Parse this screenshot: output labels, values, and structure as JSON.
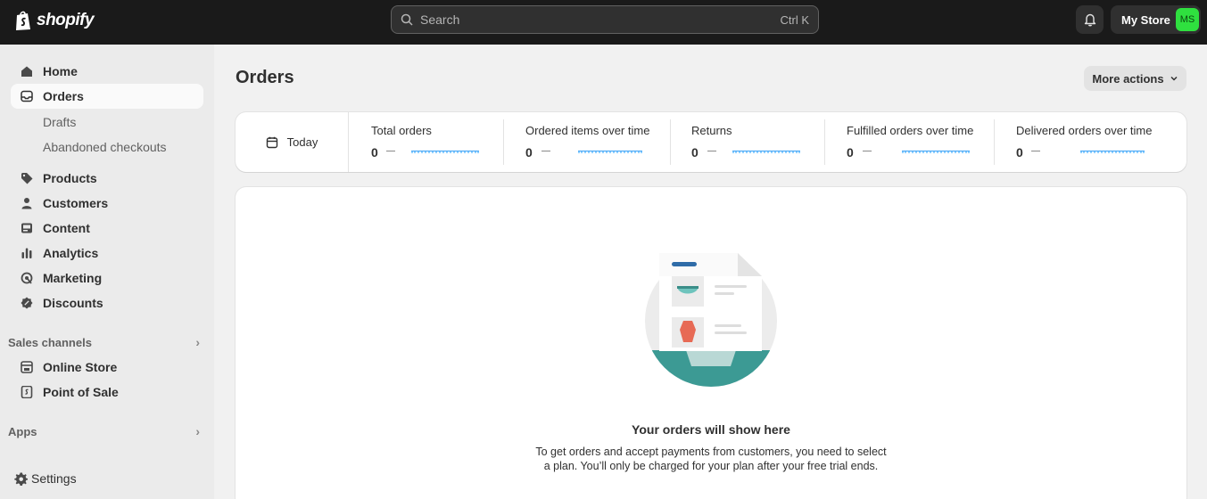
{
  "topbar": {
    "logo_text": "shopify",
    "search_placeholder": "Search",
    "search_shortcut": "Ctrl K",
    "store_name": "My Store",
    "avatar_initials": "MS"
  },
  "sidebar": {
    "items": [
      {
        "label": "Home",
        "icon": "home-icon"
      },
      {
        "label": "Orders",
        "icon": "orders-icon"
      },
      {
        "label": "Products",
        "icon": "tag-icon"
      },
      {
        "label": "Customers",
        "icon": "person-icon"
      },
      {
        "label": "Content",
        "icon": "image-icon"
      },
      {
        "label": "Analytics",
        "icon": "bar-chart-icon"
      },
      {
        "label": "Marketing",
        "icon": "target-icon"
      },
      {
        "label": "Discounts",
        "icon": "discount-icon"
      }
    ],
    "orders_sub": [
      "Drafts",
      "Abandoned checkouts"
    ],
    "sales_channels": {
      "label": "Sales channels",
      "items": [
        {
          "label": "Online Store",
          "icon": "store-icon"
        },
        {
          "label": "Point of Sale",
          "icon": "pos-icon"
        }
      ]
    },
    "apps_label": "Apps",
    "settings_label": "Settings"
  },
  "main": {
    "title": "Orders",
    "more_actions": "More actions",
    "date_filter": "Today",
    "metrics": [
      {
        "label": "Total orders",
        "value": "0"
      },
      {
        "label": "Ordered items over time",
        "value": "0"
      },
      {
        "label": "Returns",
        "value": "0"
      },
      {
        "label": "Fulfilled orders over time",
        "value": "0"
      },
      {
        "label": "Delivered orders over time",
        "value": "0"
      }
    ],
    "empty_state": {
      "title": "Your orders will show here",
      "description": "To get orders and accept payments from customers, you need to select a plan. You’ll only be charged for your plan after your free trial ends."
    }
  },
  "colors": {
    "topbar": "#1a1a1a",
    "avatar": "#2fe03f",
    "illustration_teal": "#3c9a94"
  }
}
